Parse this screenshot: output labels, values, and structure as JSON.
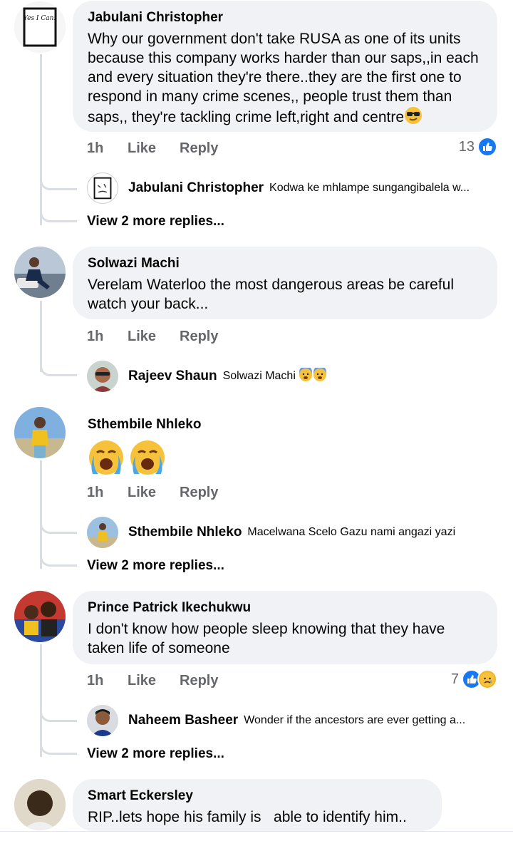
{
  "comments": [
    {
      "author": "Jabulani Christopher",
      "text": "Why our government don't take RUSA as one of its units because this company works harder than our saps,,in each and every situation they're there..they are the first one to respond in many crime scenes,, people trust them than saps,, they're tackling crime left,right and centre",
      "time": "1h",
      "like_label": "Like",
      "reply_label": "Reply",
      "reaction_count": "13",
      "avatar_text": "Yes I Can!",
      "reply_preview": {
        "author": "Jabulani Christopher",
        "text": "Kodwa ke mhlampe sungangibalela w..."
      },
      "more_replies": "View 2 more replies..."
    },
    {
      "author": "Solwazi Machi",
      "text": "Verelam Waterloo the most dangerous areas be careful watch your back...",
      "time": "1h",
      "like_label": "Like",
      "reply_label": "Reply",
      "reply_preview": {
        "author": "Rajeev Shaun",
        "text": "Solwazi Machi"
      }
    },
    {
      "author": "Sthembile Nhleko",
      "time": "1h",
      "like_label": "Like",
      "reply_label": "Reply",
      "reply_preview": {
        "author": "Sthembile Nhleko",
        "text": "Macelwana Scelo Gazu nami angazi yazi"
      },
      "more_replies": "View 2 more replies..."
    },
    {
      "author": "Prince Patrick Ikechukwu",
      "text": "I don't know how people sleep knowing that they have taken life of someone",
      "time": "1h",
      "like_label": "Like",
      "reply_label": "Reply",
      "reaction_count": "7",
      "reply_preview": {
        "author": "Naheem Basheer",
        "text": "Wonder if the ancestors are ever getting a..."
      },
      "more_replies": "View 2 more replies..."
    },
    {
      "author": "Smart Eckersley",
      "text": "RIP..lets hope his family is   able to identify him.."
    }
  ],
  "colors": {
    "bubble": "#f0f2f5",
    "like_blue": "#1877f2",
    "meta_gray": "#65676b",
    "thread_line": "#dadde1"
  }
}
